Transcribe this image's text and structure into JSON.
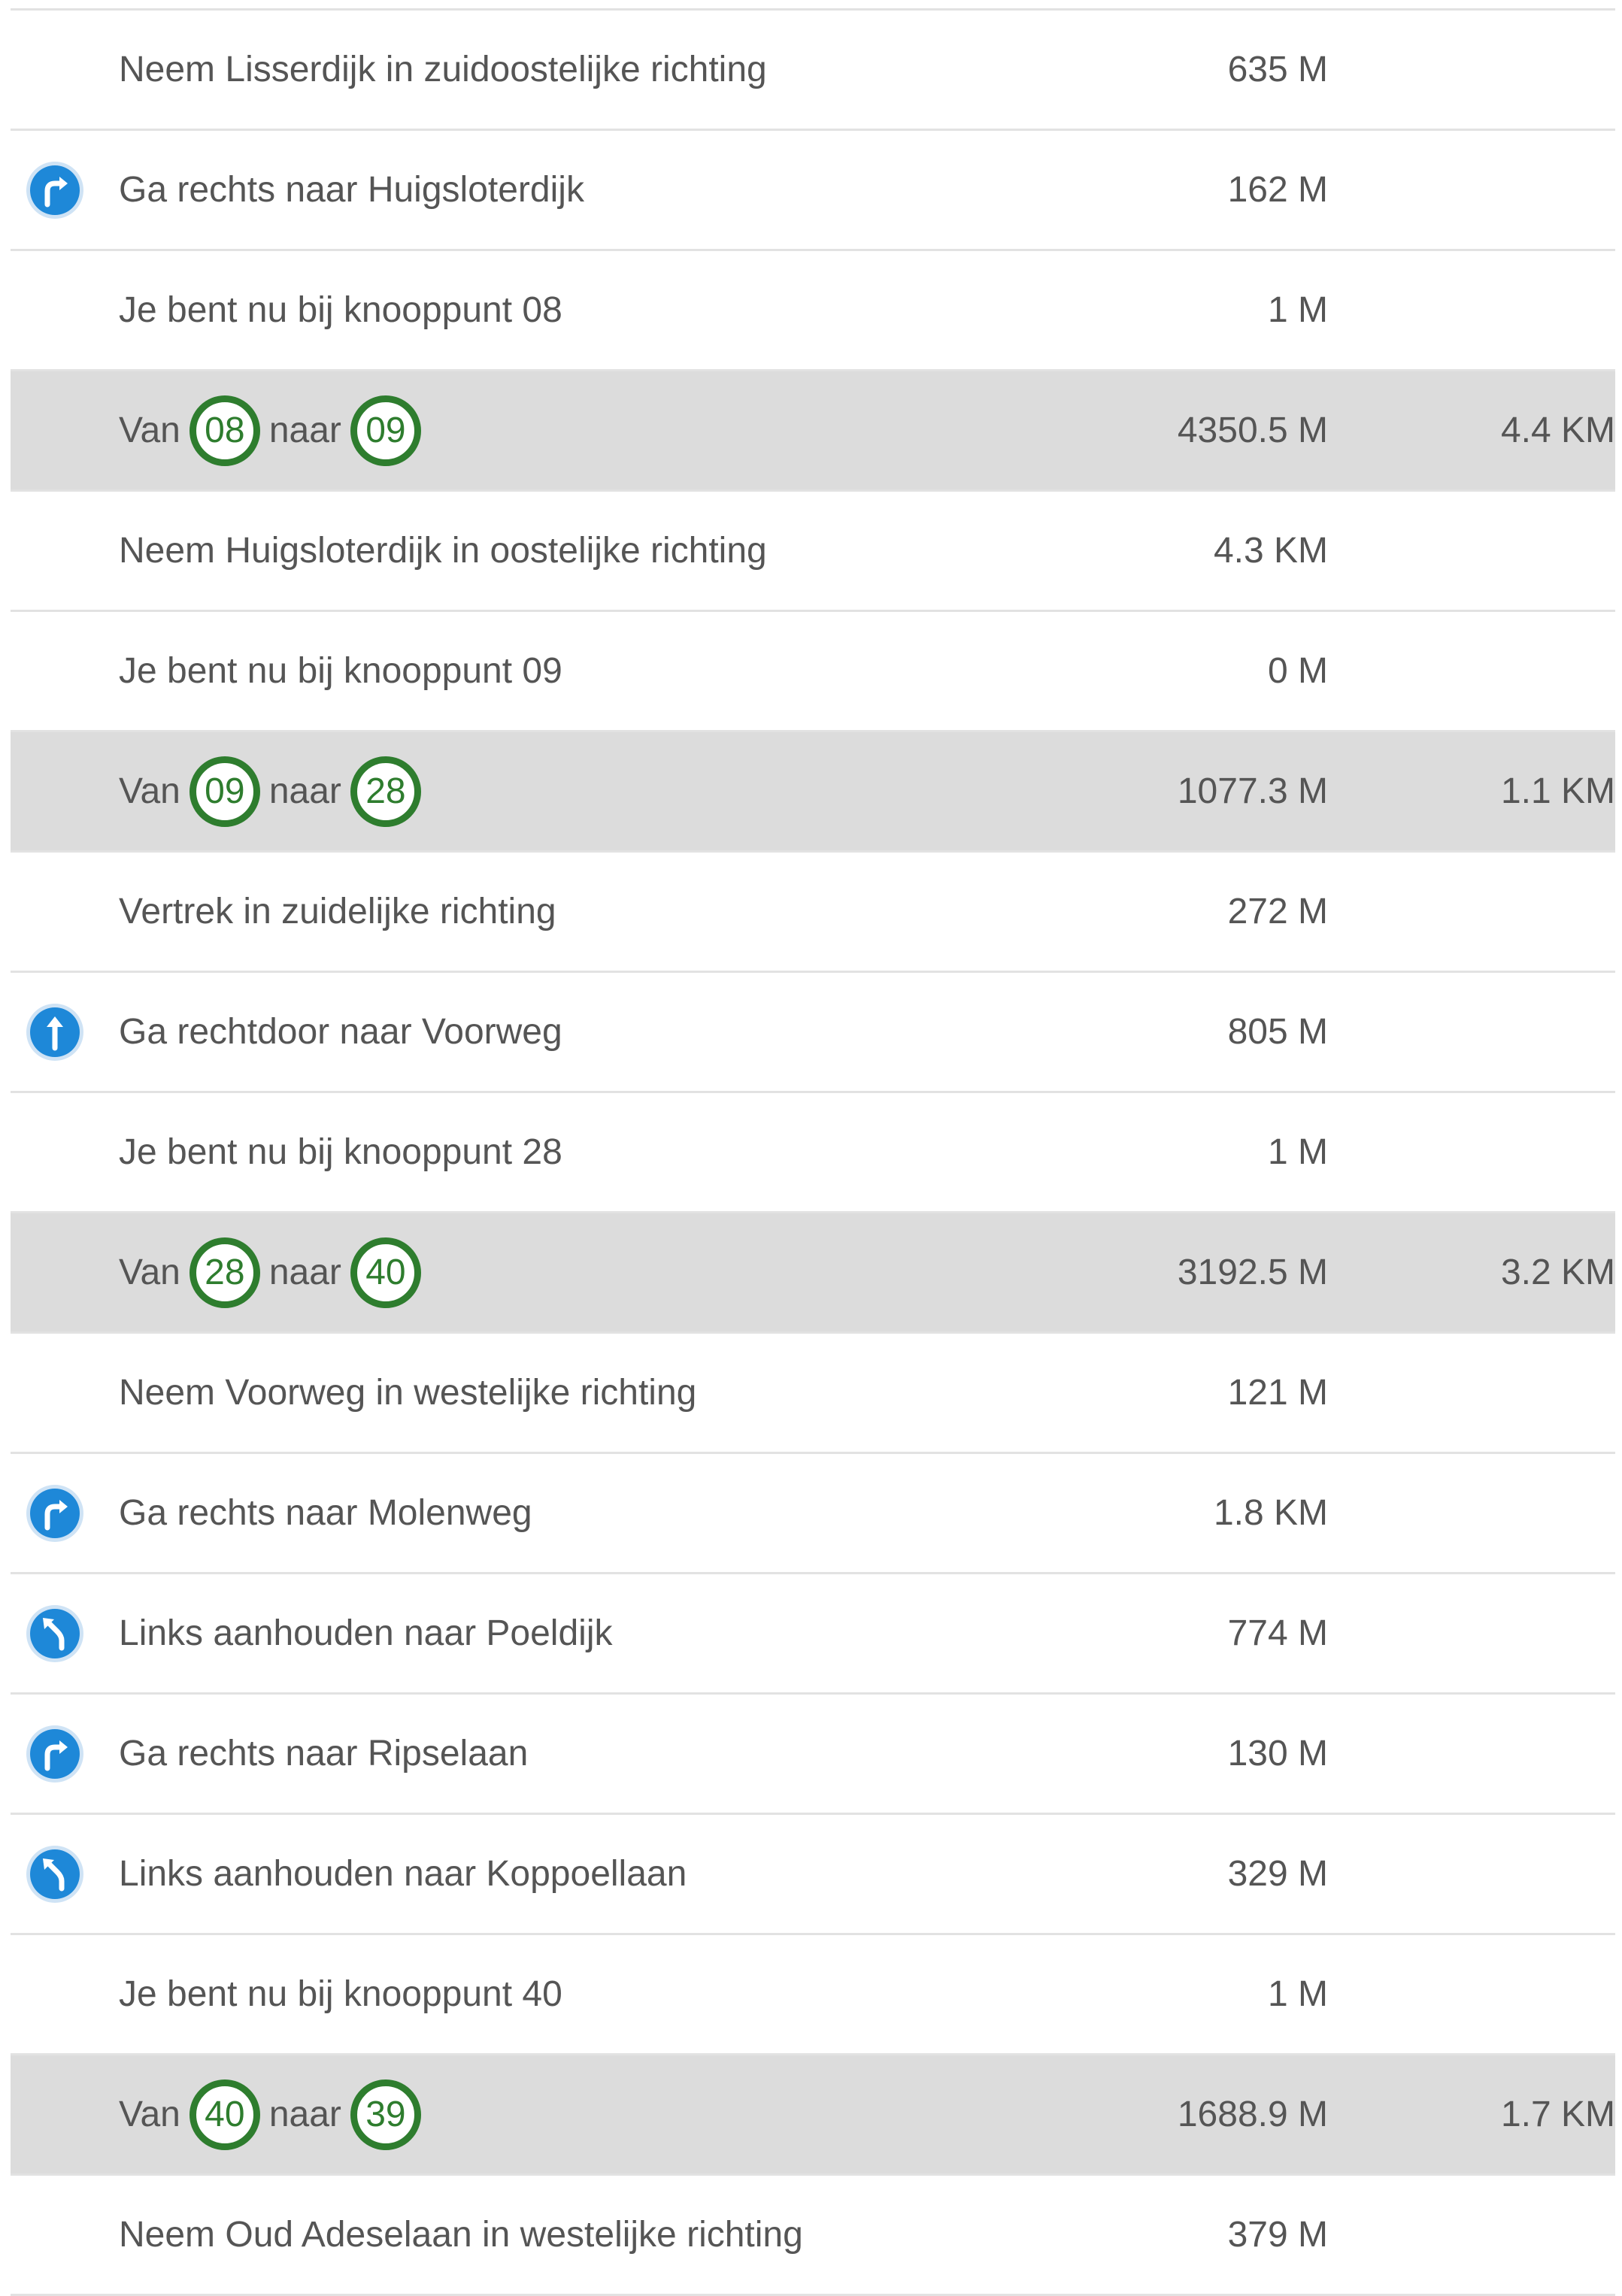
{
  "route": {
    "rows": [
      {
        "type": "step",
        "icon": null,
        "text": "Neem Lisserdijk in zuidoostelijke richting",
        "distance": "635 M"
      },
      {
        "type": "step",
        "icon": "turn-right-icon",
        "text": "Ga rechts naar Huigsloterdijk",
        "distance": "162 M"
      },
      {
        "type": "step",
        "icon": null,
        "text": "Je bent nu bij knooppunt 08",
        "distance": "1 M"
      },
      {
        "type": "segment",
        "from_label": "Van",
        "from": "08",
        "to_label": "naar",
        "to": "09",
        "distance": "4350.5 M",
        "total": "4.4 KM"
      },
      {
        "type": "step",
        "icon": null,
        "text": "Neem Huigsloterdijk in oostelijke richting",
        "distance": "4.3 KM"
      },
      {
        "type": "step",
        "icon": null,
        "text": "Je bent nu bij knooppunt 09",
        "distance": "0 M"
      },
      {
        "type": "segment",
        "from_label": "Van",
        "from": "09",
        "to_label": "naar",
        "to": "28",
        "distance": "1077.3 M",
        "total": "1.1 KM"
      },
      {
        "type": "step",
        "icon": null,
        "text": "Vertrek in zuidelijke richting",
        "distance": "272 M"
      },
      {
        "type": "step",
        "icon": "straight-ahead-icon",
        "text": "Ga rechtdoor naar Voorweg",
        "distance": "805 M"
      },
      {
        "type": "step",
        "icon": null,
        "text": "Je bent nu bij knooppunt 28",
        "distance": "1 M"
      },
      {
        "type": "segment",
        "from_label": "Van",
        "from": "28",
        "to_label": "naar",
        "to": "40",
        "distance": "3192.5 M",
        "total": "3.2 KM"
      },
      {
        "type": "step",
        "icon": null,
        "text": "Neem Voorweg in westelijke richting",
        "distance": "121 M"
      },
      {
        "type": "step",
        "icon": "turn-right-icon",
        "text": "Ga rechts naar Molenweg",
        "distance": "1.8 KM"
      },
      {
        "type": "step",
        "icon": "keep-left-icon",
        "text": "Links aanhouden naar Poeldijk",
        "distance": "774 M"
      },
      {
        "type": "step",
        "icon": "turn-right-icon",
        "text": "Ga rechts naar Ripselaan",
        "distance": "130 M"
      },
      {
        "type": "step",
        "icon": "keep-left-icon",
        "text": "Links aanhouden naar Koppoellaan",
        "distance": "329 M"
      },
      {
        "type": "step",
        "icon": null,
        "text": "Je bent nu bij knooppunt 40",
        "distance": "1 M"
      },
      {
        "type": "segment",
        "from_label": "Van",
        "from": "40",
        "to_label": "naar",
        "to": "39",
        "distance": "1688.9 M",
        "total": "1.7 KM"
      },
      {
        "type": "step",
        "icon": null,
        "text": "Neem Oud Adeselaan in westelijke richting",
        "distance": "379 M"
      }
    ]
  },
  "colors": {
    "node_green": "#2e7d2e",
    "icon_blue": "#1e88d8",
    "segment_bg": "#dcdcdc",
    "divider": "#e2e2e2",
    "text": "#555555"
  }
}
